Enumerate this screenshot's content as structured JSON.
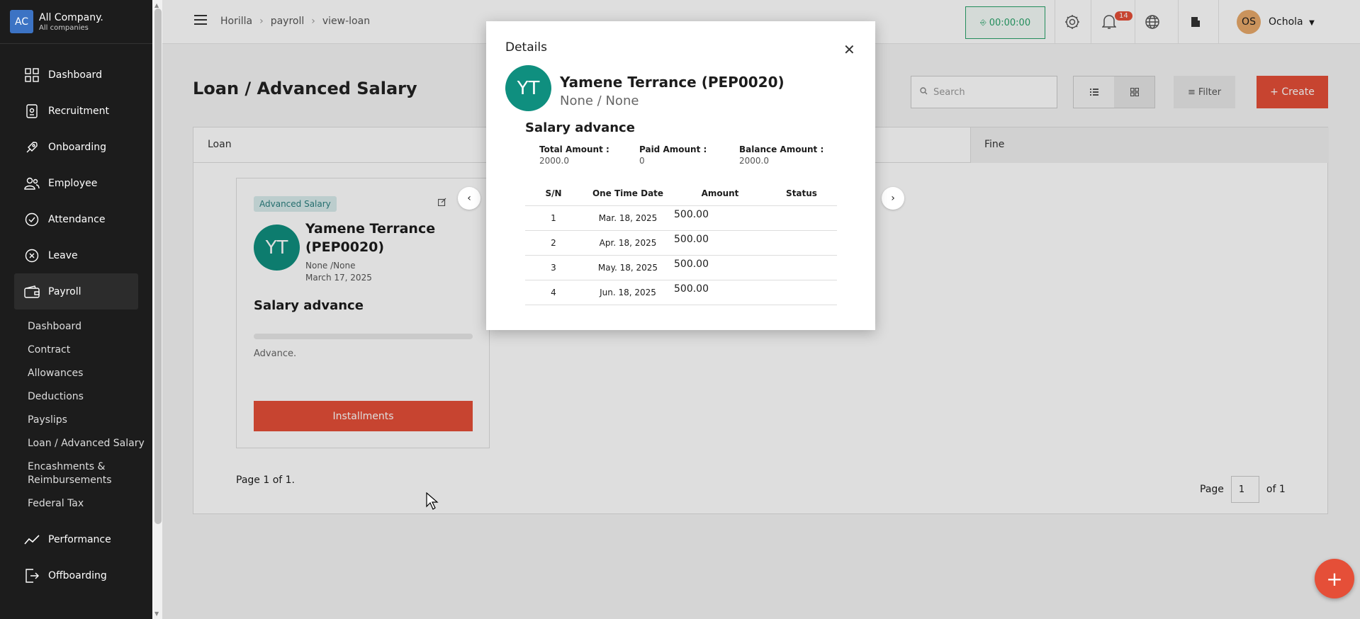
{
  "company": {
    "logo": "AC",
    "name": "All Company.",
    "sub": "All companies"
  },
  "sidebar": {
    "items": [
      {
        "label": "Dashboard",
        "icon": "grid-icon"
      },
      {
        "label": "Recruitment",
        "icon": "badge-icon"
      },
      {
        "label": "Onboarding",
        "icon": "rocket-icon"
      },
      {
        "label": "Employee",
        "icon": "people-icon"
      },
      {
        "label": "Attendance",
        "icon": "check-circle-icon"
      },
      {
        "label": "Leave",
        "icon": "x-circle-icon"
      },
      {
        "label": "Payroll",
        "icon": "wallet-icon"
      }
    ],
    "payroll_sub": [
      "Dashboard",
      "Contract",
      "Allowances",
      "Deductions",
      "Payslips",
      "Loan / Advanced Salary",
      "Encashments & Reimbursements",
      "Federal Tax"
    ],
    "bottom_items": [
      {
        "label": "Performance",
        "icon": "trend-icon"
      },
      {
        "label": "Offboarding",
        "icon": "exit-icon"
      }
    ]
  },
  "topbar": {
    "breadcrumb": [
      "Horilla",
      "payroll",
      "view-loan"
    ],
    "timer": "00:00:00",
    "notifications": "14",
    "user_initials": "OS",
    "user_name": "Ochola"
  },
  "page": {
    "title": "Loan / Advanced Salary",
    "search_placeholder": "Search",
    "filter_label": "Filter",
    "create_label": "+ Create",
    "tabs": [
      "Loan",
      "Fine"
    ],
    "page_info": "Page 1 of 1.",
    "pager": {
      "label": "Page",
      "value": "1",
      "of": "of 1"
    }
  },
  "card": {
    "tag": "Advanced Salary",
    "initials": "YT",
    "name": "Yamene Terrance (PEP0020)",
    "meta1": "None /None",
    "meta2": "March 17, 2025",
    "title": "Salary advance",
    "desc": "Advance.",
    "button": "Installments",
    "progress": 0
  },
  "modal": {
    "title": "Details",
    "initials": "YT",
    "name": "Yamene Terrance (PEP0020)",
    "sub": "None / None",
    "section": "Salary advance",
    "stats": [
      {
        "label": "Total Amount :",
        "value": "2000.0"
      },
      {
        "label": "Paid Amount :",
        "value": "0"
      },
      {
        "label": "Balance Amount :",
        "value": "2000.0"
      }
    ],
    "columns": [
      "S/N",
      "One Time Date",
      "Amount",
      "Status"
    ],
    "rows": [
      [
        "1",
        "Mar. 18, 2025",
        "500.00",
        ""
      ],
      [
        "2",
        "Apr. 18, 2025",
        "500.00",
        ""
      ],
      [
        "3",
        "May. 18, 2025",
        "500.00",
        ""
      ],
      [
        "4",
        "Jun. 18, 2025",
        "500.00",
        ""
      ]
    ]
  },
  "colors": {
    "accent": "#e54f38",
    "teal": "#0f8f7f",
    "timer": "#29a36a",
    "sidebar": "#1c1c1c"
  }
}
